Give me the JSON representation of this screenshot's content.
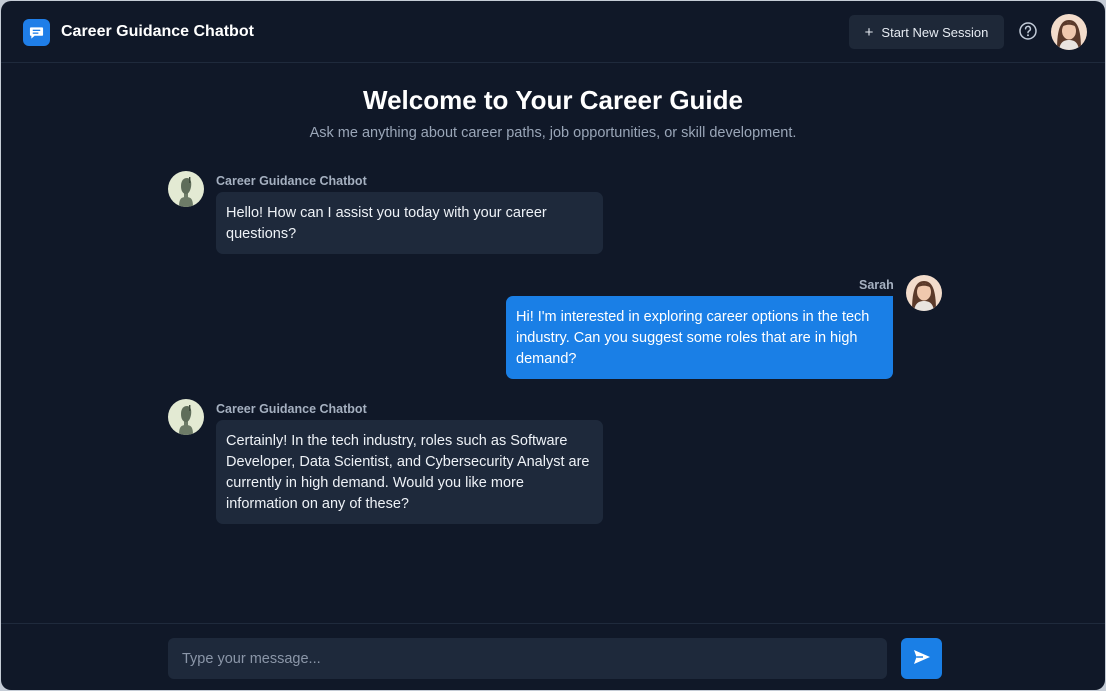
{
  "header": {
    "title": "Career Guidance Chatbot",
    "new_session_label": "Start New Session",
    "help_icon": "help-circle-icon",
    "logo_icon": "chat-bubble-icon"
  },
  "welcome": {
    "title": "Welcome to Your Career Guide",
    "subtitle": "Ask me anything about career paths, job opportunities, or skill development."
  },
  "messages": [
    {
      "role": "bot",
      "sender": "Career Guidance Chatbot",
      "text": "Hello! How can I assist you today with your career questions?"
    },
    {
      "role": "user",
      "sender": "Sarah",
      "text": "Hi! I'm interested in exploring career options in the tech industry. Can you suggest some roles that are in high demand?"
    },
    {
      "role": "bot",
      "sender": "Career Guidance Chatbot",
      "text": "Certainly! In the tech industry, roles such as Software Developer, Data Scientist, and Cybersecurity Analyst are currently in high demand. Would you like more information on any of these?"
    }
  ],
  "composer": {
    "placeholder": "Type your message...",
    "value": "",
    "send_icon": "send-icon"
  },
  "colors": {
    "background": "#101828",
    "accent": "#1a7fe6",
    "bot_bubble": "#1e293b"
  }
}
